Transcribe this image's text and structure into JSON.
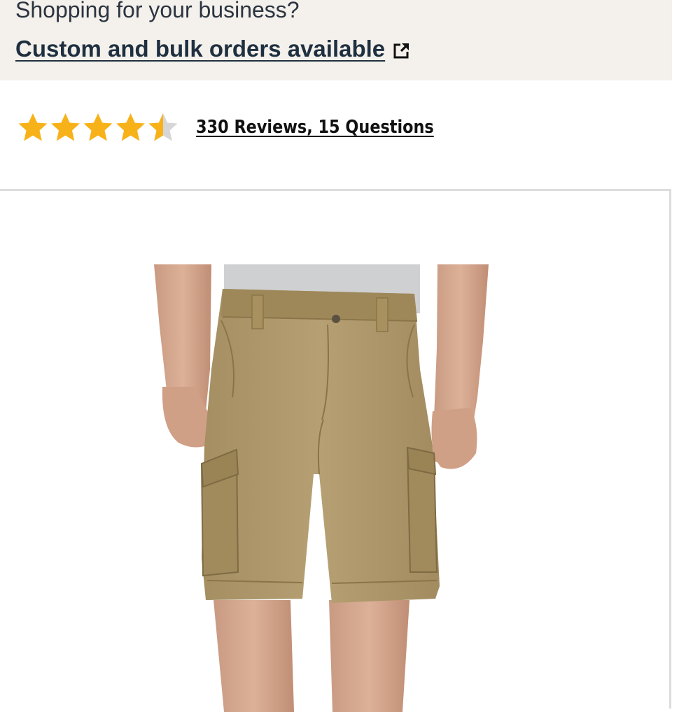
{
  "business_banner": {
    "question": "Shopping for your business?",
    "link_label": "Custom and bulk orders available",
    "link_icon": "external-link-icon"
  },
  "rating": {
    "stars": 4.5,
    "max_stars": 5,
    "reviews_label": "330 Reviews, 15 Questions",
    "star_color": "#f7b21a",
    "empty_star_color": "#d6d6d6"
  },
  "product_image": {
    "subject": "khaki cargo shorts",
    "shorts_color": "#b09a6d",
    "shirt_color": "#cfd0d2"
  }
}
